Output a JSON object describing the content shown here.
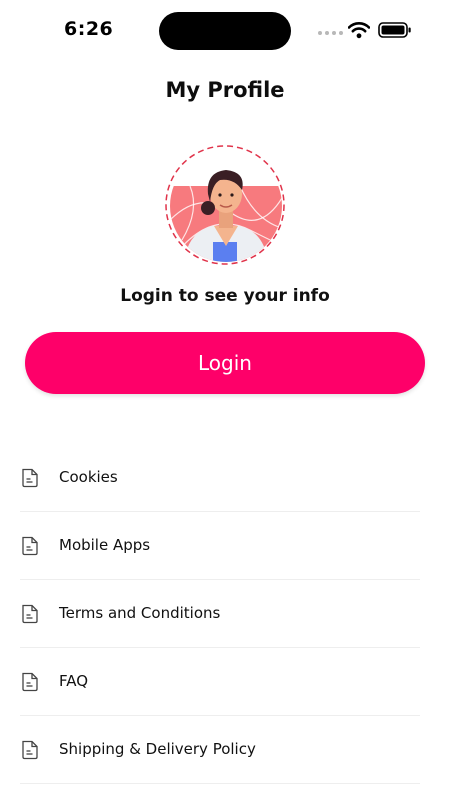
{
  "status_bar": {
    "time": "6:26"
  },
  "header": {
    "title": "My Profile"
  },
  "profile": {
    "prompt": "Login to see your info"
  },
  "login_button": {
    "label": "Login"
  },
  "colors": {
    "accent": "#fe0069",
    "avatar_ring": "#e0334a",
    "avatar_bg": "#f77a7e"
  },
  "menu": {
    "items": [
      {
        "label": "Cookies",
        "icon": "document-icon"
      },
      {
        "label": "Mobile Apps",
        "icon": "document-icon"
      },
      {
        "label": "Terms and Conditions",
        "icon": "document-icon"
      },
      {
        "label": "FAQ",
        "icon": "document-icon"
      },
      {
        "label": "Shipping & Delivery Policy",
        "icon": "document-icon"
      }
    ]
  }
}
